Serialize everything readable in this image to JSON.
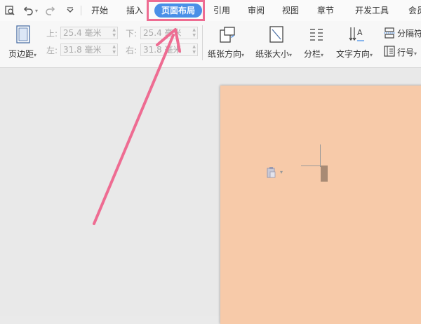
{
  "colors": {
    "accent": "#4a8fe7",
    "annotation": "#ee6c92",
    "page_background": "#f7caa9"
  },
  "quick_access": {
    "icons": [
      "print-preview-icon",
      "undo-icon",
      "redo-icon",
      "customize-icon"
    ]
  },
  "menu": {
    "tabs": [
      {
        "label": "开始"
      },
      {
        "label": "插入"
      },
      {
        "label": "页面布局",
        "active": true
      },
      {
        "label": "引用"
      },
      {
        "label": "审阅"
      },
      {
        "label": "视图"
      },
      {
        "label": "章节"
      },
      {
        "label": "开发工具"
      },
      {
        "label": "会员"
      }
    ]
  },
  "ribbon": {
    "margins_label": "页边距",
    "margin_top_label": "上:",
    "margin_top_value": "25.4 毫米",
    "margin_bottom_label": "下:",
    "margin_bottom_value": "25.4 毫米",
    "margin_left_label": "左:",
    "margin_left_value": "31.8 毫米",
    "margin_right_label": "右:",
    "margin_right_value": "31.8 毫米",
    "orientation_label": "纸张方向",
    "paper_size_label": "纸张大小",
    "columns_label": "分栏",
    "text_direction_label": "文字方向",
    "separator_label": "分隔符",
    "line_number_label": "行号"
  }
}
